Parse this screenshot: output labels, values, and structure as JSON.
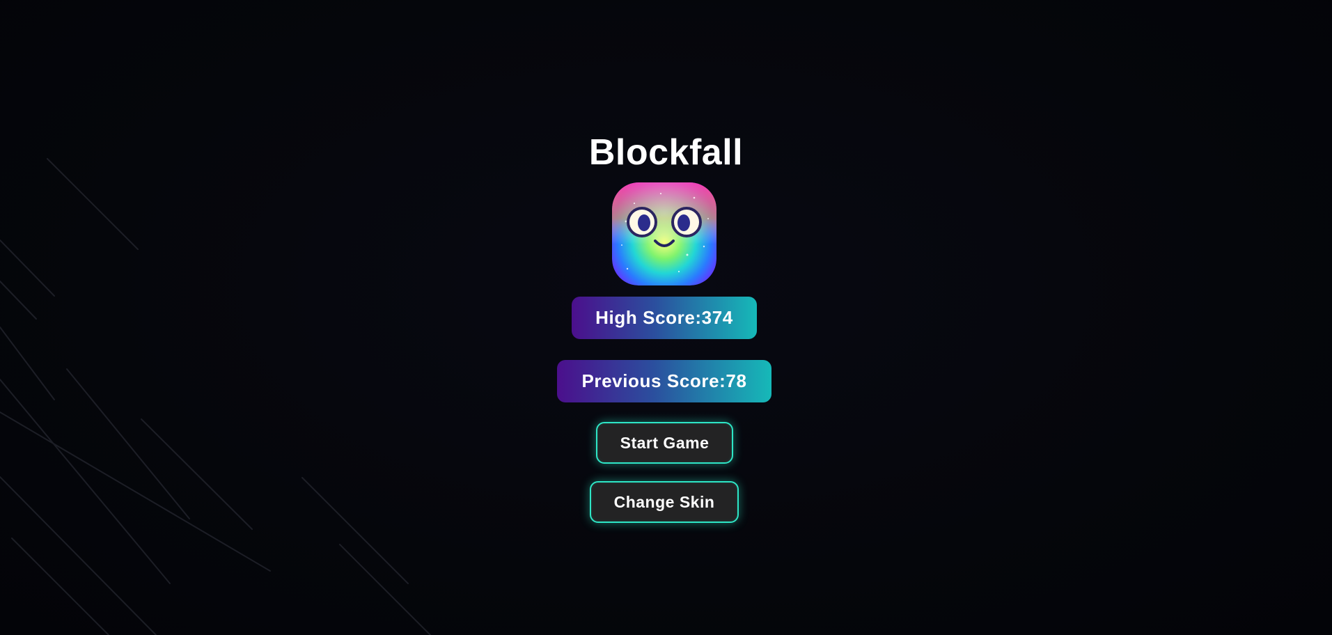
{
  "game": {
    "title": "Blockfall"
  },
  "scores": {
    "high_label": "High Score:",
    "high_value": "374",
    "previous_label": "Previous Score:",
    "previous_value": "78"
  },
  "buttons": {
    "start": "Start Game",
    "change_skin": "Change Skin"
  },
  "colors": {
    "background": "#05060b",
    "accent_glow": "#2ee6c6",
    "pill_gradient_start": "#4b0f8c",
    "pill_gradient_end": "#16b9b8",
    "button_fill": "#232324"
  },
  "icons": {
    "mascot": "rainbow-smiley-block-icon"
  }
}
